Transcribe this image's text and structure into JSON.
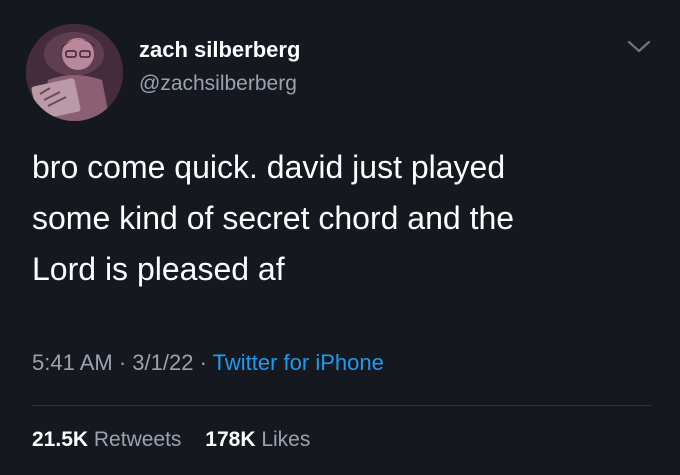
{
  "tweet": {
    "author": {
      "display_name": "zach silberberg",
      "handle": "@zachsilberberg"
    },
    "text_lines": [
      "bro come quick. david just played",
      "some kind of secret chord and the",
      "Lord is pleased af"
    ],
    "time": "5:41 AM",
    "date": "3/1/22",
    "separator": "·",
    "source": "Twitter for iPhone",
    "stats": {
      "retweets_count": "21.5K",
      "retweets_label": "Retweets",
      "likes_count": "178K",
      "likes_label": "Likes"
    },
    "icons": {
      "menu": "chevron-down-icon",
      "avatar": "avatar"
    },
    "colors": {
      "background": "#15181f",
      "secondary_text": "#9aa3ad",
      "link": "#1d9bf0"
    }
  }
}
